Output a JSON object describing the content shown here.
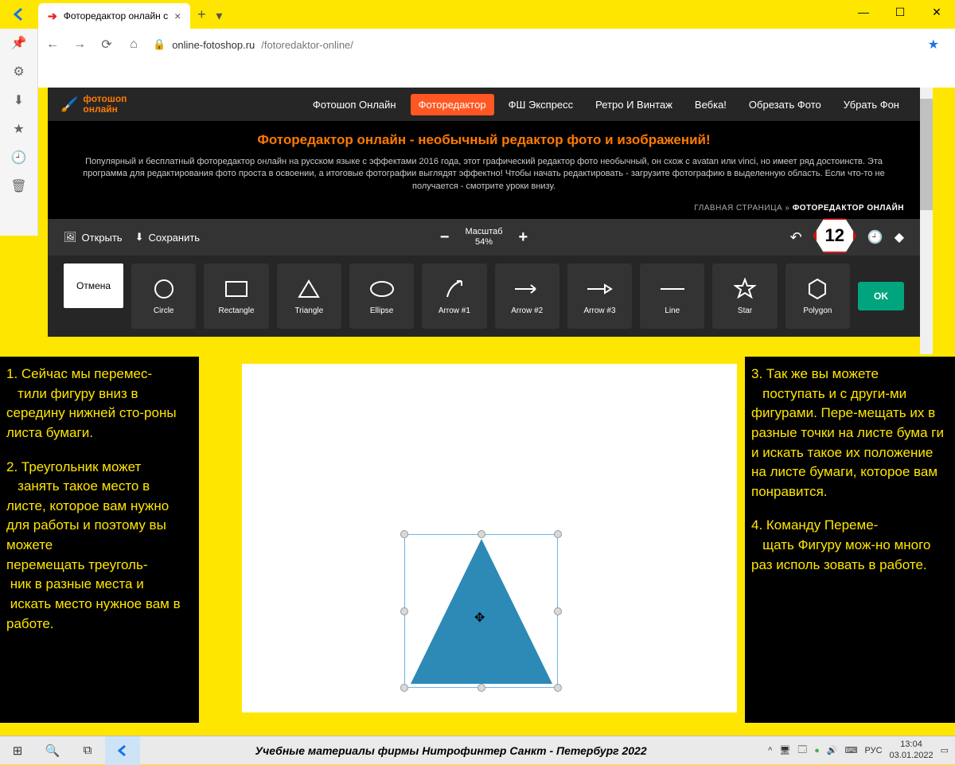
{
  "browser": {
    "tab_title": "Фоторедактор онлайн с",
    "url_host": "online-fotoshop.ru",
    "url_path": "/fotoredaktor-online/"
  },
  "site": {
    "logo_line1": "фотошоп",
    "logo_line2": "онлайн",
    "nav": [
      "Фотошоп Онлайн",
      "Фоторедактор",
      "ФШ Экспресс",
      "Ретро И Винтаж",
      "Вебка!",
      "Обрезать Фото",
      "Убрать Фон"
    ],
    "nav_active_index": 1,
    "hero_title": "Фоторедактор онлайн - необычный редактор фото и изображений!",
    "hero_desc": "Популярный и бесплатный фоторедактор онлайн на русском языке с эффектами 2016 года, этот графический редактор фото необычный, он схож с avatan или vinci, но имеет ряд достоинств. Эта программа для редактирования фото проста в освоении, а итоговые фотографии выглядят эффектно! Чтобы начать редактировать - загрузите фотографию в выделенную область. Если что-то не получается - смотрите уроки внизу.",
    "breadcrumb_home": "ГЛАВНАЯ СТРАНИЦА",
    "breadcrumb_sep": "»",
    "breadcrumb_current": "ФОТОРЕДАКТОР ОНЛАЙН"
  },
  "toolbar": {
    "open": "Открыть",
    "save": "Сохранить",
    "zoom_label": "Масштаб",
    "zoom_value": "54%",
    "badge": "12"
  },
  "shapes": {
    "cancel": "Отмена",
    "ok": "OK",
    "items": [
      {
        "label": "Circle"
      },
      {
        "label": "Rectangle"
      },
      {
        "label": "Triangle"
      },
      {
        "label": "Ellipse"
      },
      {
        "label": "Arrow #1"
      },
      {
        "label": "Arrow #2"
      },
      {
        "label": "Arrow #3"
      },
      {
        "label": "Line"
      },
      {
        "label": "Star"
      },
      {
        "label": "Polygon"
      }
    ]
  },
  "overlay": {
    "left_p1": "1. Сейчас мы перемес-\n   тили фигуру вниз в середину нижней сто-роны листа бумаги.",
    "left_p2": "2. Треугольник может\n   занять такое место в листе, которое вам нужно для работы и поэтому вы можете\n перемещать треуголь-\n ник в разные места и\n искать место нужное вам в работе.",
    "right_p1": "3. Так же вы можете\n   поступать и с други-ми фигурами. Пере-мещать их в разные точки на листе бума ги и искать такое их положение на листе бумаги, которое вам понравится.",
    "right_p2": "4. Команду Переме-\n   щать Фигуру мож-но много раз исполь зовать в работе."
  },
  "taskbar": {
    "caption": "Учебные материалы фирмы Нитрофинтер  Санкт - Петербург  2022",
    "lang": "РУС",
    "time": "13:04",
    "date": "03.01.2022"
  }
}
